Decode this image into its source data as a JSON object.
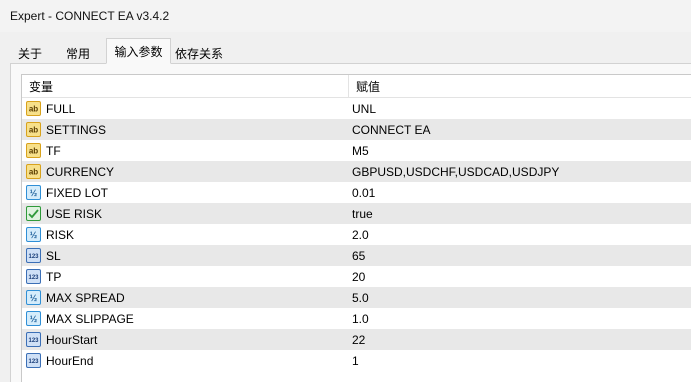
{
  "window": {
    "title": "Expert - CONNECT EA v3.4.2"
  },
  "tabs": [
    {
      "label": "关于",
      "active": false
    },
    {
      "label": "常用",
      "active": false
    },
    {
      "label": "输入参数",
      "active": true
    },
    {
      "label": "依存关系",
      "active": false
    }
  ],
  "table": {
    "columns": [
      "变量",
      "赋值"
    ],
    "rows": [
      {
        "name": "FULL",
        "value": "UNL",
        "type": "ab"
      },
      {
        "name": "SETTINGS",
        "value": "CONNECT EA",
        "type": "ab"
      },
      {
        "name": "TF",
        "value": "M5",
        "type": "ab"
      },
      {
        "name": "CURRENCY",
        "value": "GBPUSD,USDCHF,USDCAD,USDJPY",
        "type": "ab"
      },
      {
        "name": "FIXED LOT",
        "value": "0.01",
        "type": "v2"
      },
      {
        "name": "USE RISK",
        "value": "true",
        "type": "bool"
      },
      {
        "name": "RISK",
        "value": "2.0",
        "type": "v2"
      },
      {
        "name": "SL",
        "value": "65",
        "type": "123"
      },
      {
        "name": "TP",
        "value": "20",
        "type": "123"
      },
      {
        "name": "MAX SPREAD",
        "value": "5.0",
        "type": "v2"
      },
      {
        "name": "MAX SLIPPAGE",
        "value": "1.0",
        "type": "v2"
      },
      {
        "name": "HourStart",
        "value": "22",
        "type": "123"
      },
      {
        "name": "HourEnd",
        "value": "1",
        "type": "123"
      }
    ]
  },
  "icons": {
    "ab": {
      "name": "string-type-icon",
      "text": "ab",
      "color": "#d8a21c"
    },
    "v2": {
      "name": "double-type-icon",
      "text": "½",
      "color": "#2f8fd6"
    },
    "123": {
      "name": "integer-type-icon",
      "text": "123",
      "color": "#3b6fb6"
    },
    "bool": {
      "name": "bool-type-icon",
      "color": "#2f9a3a"
    }
  }
}
